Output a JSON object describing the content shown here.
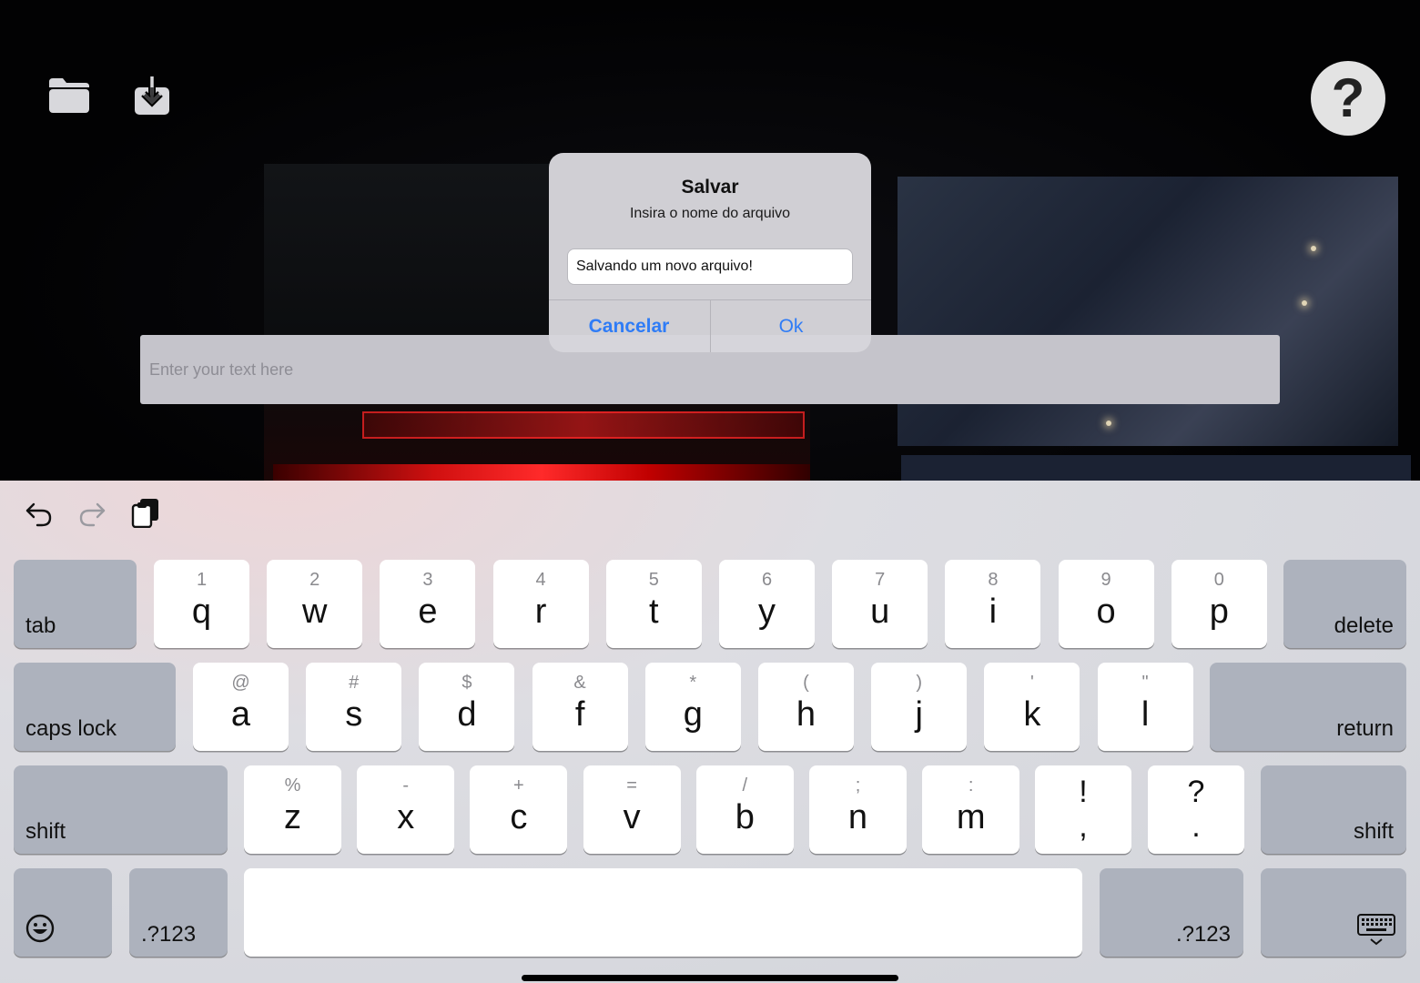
{
  "toolbar": {
    "folder_icon": "folder-icon",
    "save_icon": "download-icon",
    "help_label": "?"
  },
  "main_input": {
    "placeholder": "Enter your text here"
  },
  "dialog": {
    "title": "Salvar",
    "message": "Insira o nome do arquivo",
    "field_value": "Salvando um novo arquivo!",
    "cancel_label": "Cancelar",
    "ok_label": "Ok",
    "accent_color": "#2f7cf6"
  },
  "keyboard": {
    "toolbar_icons": [
      "undo-icon",
      "redo-icon",
      "clipboard-icon"
    ],
    "row1": {
      "tab": "tab",
      "keys": [
        {
          "main": "q",
          "sub": "1"
        },
        {
          "main": "w",
          "sub": "2"
        },
        {
          "main": "e",
          "sub": "3"
        },
        {
          "main": "r",
          "sub": "4"
        },
        {
          "main": "t",
          "sub": "5"
        },
        {
          "main": "y",
          "sub": "6"
        },
        {
          "main": "u",
          "sub": "7"
        },
        {
          "main": "i",
          "sub": "8"
        },
        {
          "main": "o",
          "sub": "9"
        },
        {
          "main": "p",
          "sub": "0"
        }
      ],
      "delete": "delete"
    },
    "row2": {
      "caps": "caps lock",
      "keys": [
        {
          "main": "a",
          "sub": "@"
        },
        {
          "main": "s",
          "sub": "#"
        },
        {
          "main": "d",
          "sub": "$"
        },
        {
          "main": "f",
          "sub": "&"
        },
        {
          "main": "g",
          "sub": "*"
        },
        {
          "main": "h",
          "sub": "("
        },
        {
          "main": "j",
          "sub": ")"
        },
        {
          "main": "k",
          "sub": "'"
        },
        {
          "main": "l",
          "sub": "\""
        }
      ],
      "return": "return"
    },
    "row3": {
      "shift_left": "shift",
      "keys": [
        {
          "main": "z",
          "sub": "%"
        },
        {
          "main": "x",
          "sub": "-"
        },
        {
          "main": "c",
          "sub": "+"
        },
        {
          "main": "v",
          "sub": "="
        },
        {
          "main": "b",
          "sub": "/"
        },
        {
          "main": "n",
          "sub": ";"
        },
        {
          "main": "m",
          "sub": ":"
        }
      ],
      "punct": [
        {
          "top": "!",
          "bottom": ","
        },
        {
          "top": "?",
          "bottom": "."
        }
      ],
      "shift_right": "shift"
    },
    "row4": {
      "emoji_icon": "emoji-icon",
      "num_left": ".?123",
      "num_right": ".?123",
      "dismiss_icon": "keyboard-dismiss-icon"
    }
  }
}
